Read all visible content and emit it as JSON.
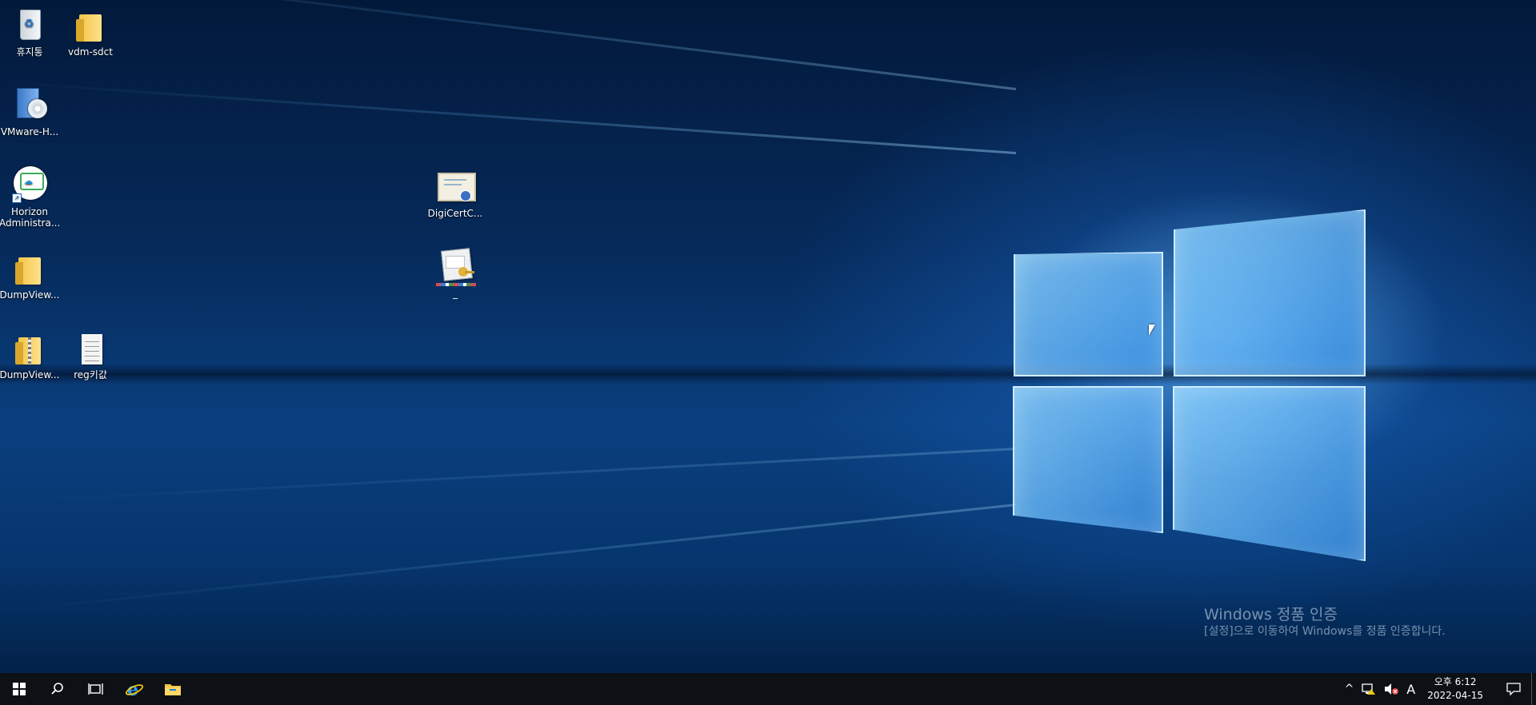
{
  "desktop": {
    "icons": [
      {
        "label": "휴지통",
        "icon": "recycle-bin-icon"
      },
      {
        "label": "vdm-sdct",
        "icon": "folder-icon"
      },
      {
        "label": "VMware-H...",
        "icon": "installer-icon"
      },
      {
        "label": "Horizon Administra...",
        "icon": "horizon-admin-icon"
      },
      {
        "label": "DumpView...",
        "icon": "folder-icon"
      },
      {
        "label": "DumpView...",
        "icon": "zip-folder-icon"
      },
      {
        "label": "reg키값",
        "icon": "text-file-icon"
      },
      {
        "label": "DigiCertC...",
        "icon": "certificate-icon"
      },
      {
        "label": "_",
        "icon": "certificate-key-icon"
      }
    ],
    "watermark": {
      "title": "Windows 정품 인증",
      "subtitle": "[설정]으로 이동하여 Windows를 정품 인증합니다."
    }
  },
  "taskbar": {
    "buttons": [
      "start-icon",
      "search-icon",
      "task-view-icon",
      "internet-explorer-icon",
      "file-explorer-icon"
    ],
    "tray": {
      "chevron": "^",
      "network": "network-warning-icon",
      "volume": "volume-muted-icon",
      "ime": "A",
      "time": "오후 6:12",
      "date": "2022-04-15"
    }
  }
}
